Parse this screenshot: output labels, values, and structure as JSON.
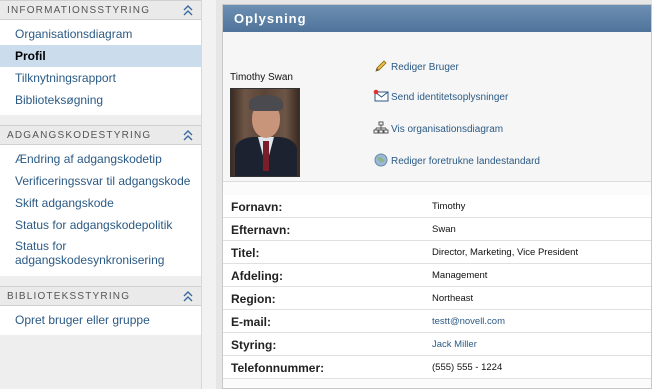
{
  "nav": {
    "sections": [
      {
        "title": "INFORMATIONSSTYRING",
        "items": [
          {
            "label": "Organisationsdiagram"
          },
          {
            "label": "Profil",
            "active": true
          },
          {
            "label": "Tilknytningsrapport"
          },
          {
            "label": "Biblioteksøgning"
          }
        ]
      },
      {
        "title": "ADGANGSKODESTYRING",
        "items": [
          {
            "label": "Ændring af adgangskodetip"
          },
          {
            "label": "Verificeringssvar til adgangskode"
          },
          {
            "label": "Skift adgangskode"
          },
          {
            "label": "Status for adgangskodepolitik"
          },
          {
            "label": "Status for adgangskodesynkronisering"
          }
        ]
      },
      {
        "title": "BIBLIOTEKSSTYRING",
        "items": [
          {
            "label": "Opret bruger eller gruppe"
          }
        ]
      }
    ]
  },
  "panel": {
    "title": "Oplysning",
    "user_name": "Timothy Swan",
    "actions": [
      {
        "label": "Rediger Bruger",
        "icon": "pencil-icon"
      },
      {
        "label": "Send identitetsoplysninger",
        "icon": "envelope-icon"
      },
      {
        "label": "Vis organisationsdiagram",
        "icon": "org-chart-icon"
      },
      {
        "label": "Rediger foretrukne landestandard",
        "icon": "globe-icon"
      }
    ],
    "fields": [
      {
        "key": "Fornavn:",
        "value": "Timothy"
      },
      {
        "key": "Efternavn:",
        "value": "Swan"
      },
      {
        "key": "Titel:",
        "value": "Director, Marketing, Vice President"
      },
      {
        "key": "Afdeling:",
        "value": "Management"
      },
      {
        "key": "Region:",
        "value": "Northeast"
      },
      {
        "key": "E-mail:",
        "value": "testt@novell.com",
        "link": true
      },
      {
        "key": "Styring:",
        "value": "Jack Miller",
        "link": true
      },
      {
        "key": "Telefonnummer:",
        "value": "(555) 555 - 1224"
      }
    ]
  }
}
